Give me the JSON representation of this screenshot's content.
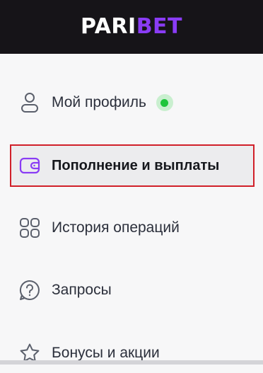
{
  "header": {
    "logo_part1": "PARI",
    "logo_part2": "BET"
  },
  "menu": {
    "items": [
      {
        "label": "Мой профиль",
        "icon": "user-icon",
        "status": "online"
      },
      {
        "label": "Пополнение и выплаты",
        "icon": "wallet-icon",
        "active": true
      },
      {
        "label": "История операций",
        "icon": "grid-icon"
      },
      {
        "label": "Запросы",
        "icon": "question-icon"
      },
      {
        "label": "Бонусы и акции",
        "icon": "star-icon"
      }
    ]
  },
  "colors": {
    "header_bg": "#161418",
    "brand_accent": "#8a3cf5",
    "active_border": "#d1202a",
    "online": "#1ec53b"
  }
}
